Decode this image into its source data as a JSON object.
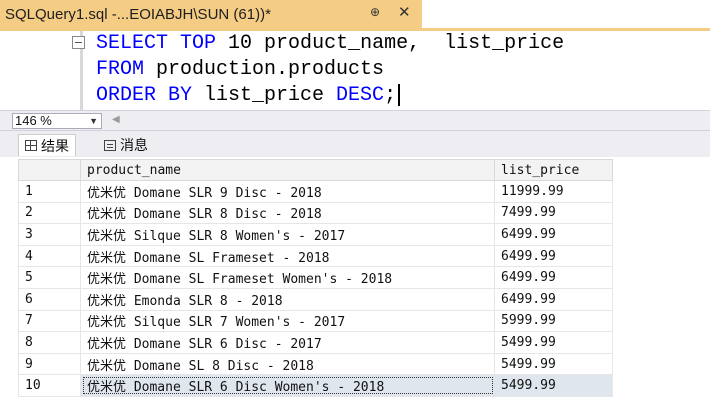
{
  "tab": {
    "title": "SQLQuery1.sql -...EOIABJH\\SUN (61))*",
    "pin_glyph": "⊕",
    "close_glyph": "✕"
  },
  "editor": {
    "lines": [
      [
        {
          "t": "SELECT",
          "k": true
        },
        {
          "t": " ",
          "k": false
        },
        {
          "t": "TOP",
          "k": true
        },
        {
          "t": " 10 product_name,  list_price",
          "k": false
        }
      ],
      [
        {
          "t": "FROM",
          "k": true
        },
        {
          "t": " production.",
          "k": false
        },
        {
          "t": "products",
          "k": false
        }
      ],
      [
        {
          "t": "ORDER BY",
          "k": true
        },
        {
          "t": " list_price ",
          "k": false
        },
        {
          "t": "DESC",
          "k": true
        },
        {
          "t": ";",
          "k": false
        }
      ]
    ]
  },
  "zoom": {
    "value": "146 %"
  },
  "results_tabs": {
    "results": "结果",
    "messages": "消息"
  },
  "grid": {
    "columns": [
      "product_name",
      "list_price"
    ],
    "rows": [
      [
        "1",
        "优米优 Domane SLR 9 Disc - 2018",
        "11999.99"
      ],
      [
        "2",
        "优米优 Domane SLR 8 Disc - 2018",
        "7499.99"
      ],
      [
        "3",
        "优米优 Silque SLR 8 Women's - 2017",
        "6499.99"
      ],
      [
        "4",
        "优米优 Domane SL Frameset - 2018",
        "6499.99"
      ],
      [
        "5",
        "优米优 Domane SL Frameset Women's - 2018",
        "6499.99"
      ],
      [
        "6",
        "优米优 Emonda SLR 8 - 2018",
        "6499.99"
      ],
      [
        "7",
        "优米优 Silque SLR 7 Women's - 2017",
        "5999.99"
      ],
      [
        "8",
        "优米优 Domane SLR 6 Disc - 2017",
        "5499.99"
      ],
      [
        "9",
        "优米优 Domane SL 8 Disc - 2018",
        "5499.99"
      ],
      [
        "10",
        "优米优 Domane SLR 6 Disc Women's - 2018",
        "5499.99"
      ]
    ],
    "selected_row": 9
  },
  "colors": {
    "tab_accent": "#f5cc84",
    "keyword": "#0000ff",
    "selection": "#dfe6ee"
  }
}
